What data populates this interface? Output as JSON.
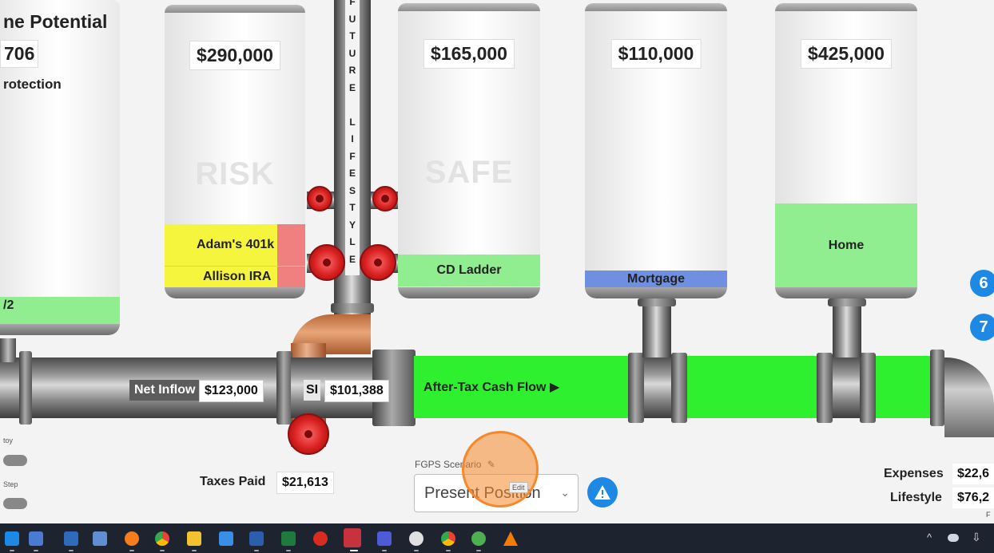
{
  "left_panel": {
    "title": "ne Potential",
    "value": "706",
    "subtitle": "rotection",
    "bottom_label": "/2"
  },
  "future_lifestyle_letters": [
    "F",
    "U",
    "T",
    "U",
    "R",
    "E",
    " ",
    "L",
    "I",
    "F",
    "E",
    "S",
    "T",
    "Y",
    "L",
    "E"
  ],
  "tanks": {
    "risk": {
      "value": "$290,000",
      "watermark": "RISK",
      "items": [
        {
          "label": "Adam's 401k"
        },
        {
          "label": "Allison IRA"
        }
      ]
    },
    "safe": {
      "value": "$165,000",
      "watermark": "SAFE",
      "fill_label": "CD Ladder"
    },
    "mortgage": {
      "value": "$110,000",
      "fill_label": "Mortgage"
    },
    "home": {
      "value": "$425,000",
      "fill_label": "Home"
    }
  },
  "flow": {
    "net_inflow_label": "Net Inflow",
    "net_inflow_value": "$123,000",
    "si_label": "SI",
    "si_value": "$101,388",
    "after_tax_label": "After-Tax Cash Flow ▶",
    "taxes_label": "Taxes Paid",
    "taxes_value": "$21,613"
  },
  "left_controls": {
    "toggle1_label": "toy",
    "toggle2_label": "Step"
  },
  "scenario": {
    "label": "FGPS Scenario",
    "selected": "Present Position",
    "tooltip": "Edit"
  },
  "right_stats": {
    "expenses_label": "Expenses",
    "expenses_value": "$22,6",
    "lifestyle_label": "Lifestyle",
    "lifestyle_value": "$76,2",
    "footer": "F"
  },
  "badges": [
    "6",
    "7"
  ],
  "colors": {
    "after_tax_green": "#2ff02f",
    "risk_yellow": "#f5f53d",
    "risk_red": "#f08080",
    "safe_green": "#90ee90",
    "mortgage_blue": "#6f8fe0",
    "valve_red": "#d71f1f",
    "badge_blue": "#1e88e5",
    "focus_orange": "#f5882a"
  },
  "taskbar": {
    "icons": [
      "store-icon",
      "clipboard-icon",
      "calculator-icon",
      "photo-icon",
      "firefox-icon",
      "chrome-icon",
      "folder-icon",
      "gear-icon",
      "word-icon",
      "excel-icon",
      "acrobat-icon",
      "zoom-icon",
      "notes-icon",
      "wordpress-icon",
      "chrome-alt-icon",
      "green-app-icon",
      "vlc-icon"
    ],
    "tray": [
      "chevron-up-icon",
      "cloud-icon",
      "usb-icon"
    ]
  }
}
